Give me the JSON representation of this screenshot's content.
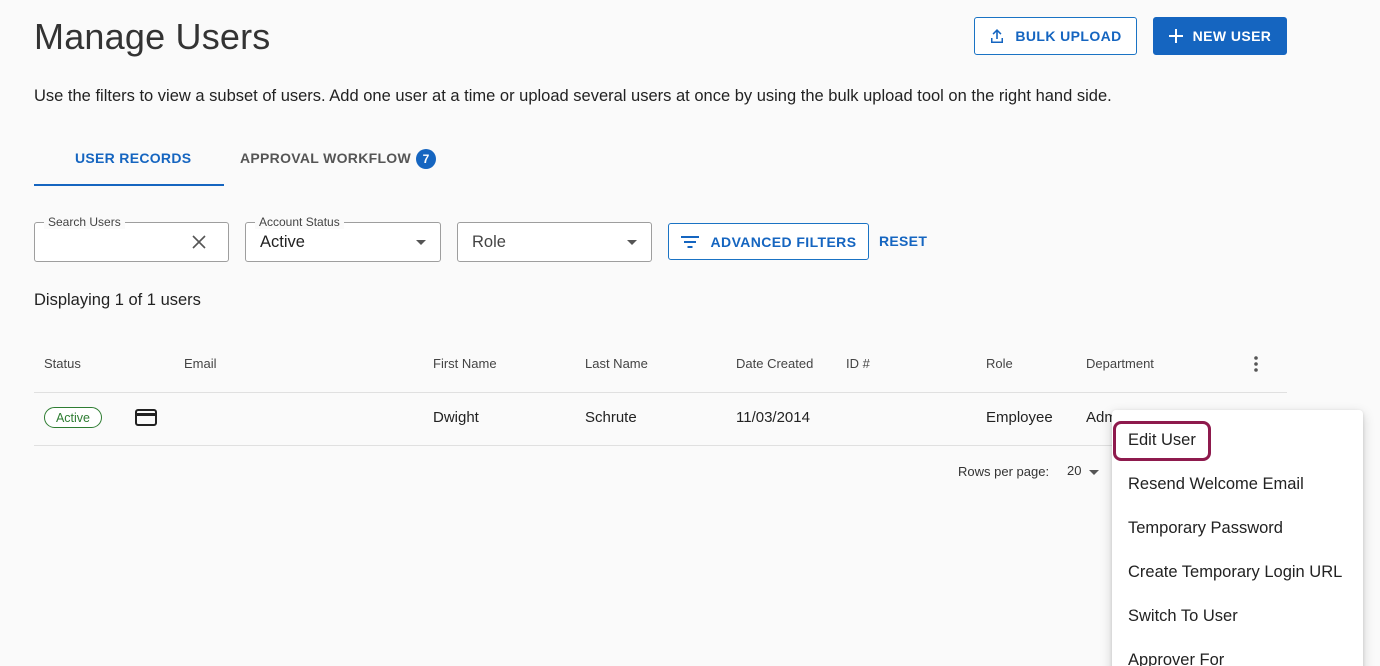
{
  "header": {
    "title": "Manage Users",
    "bulk_upload_label": "BULK UPLOAD",
    "new_user_label": "NEW USER"
  },
  "description": "Use the filters to view a subset of users. Add one user at a time or upload several users at once by using the bulk upload tool on the right hand side.",
  "tabs": {
    "records": "USER RECORDS",
    "approval": "APPROVAL WORKFLOW",
    "approval_badge": "7"
  },
  "filters": {
    "search_label": "Search Users",
    "status_label": "Account Status",
    "status_value": "Active",
    "role_placeholder": "Role",
    "advanced_label": "ADVANCED FILTERS",
    "reset_label": "RESET"
  },
  "display_count": "Displaying 1 of 1 users",
  "table": {
    "headers": {
      "status": "Status",
      "email": "Email",
      "first_name": "First Name",
      "last_name": "Last Name",
      "date_created": "Date Created",
      "id": "ID #",
      "role": "Role",
      "department": "Department"
    },
    "rows": [
      {
        "status": "Active",
        "email": "",
        "first_name": "Dwight",
        "last_name": "Schrute",
        "date_created": "11/03/2014",
        "id": "",
        "role": "Employee",
        "department": "Adm"
      }
    ]
  },
  "pagination": {
    "rows_label": "Rows per page:",
    "rows_value": "20"
  },
  "context_menu": {
    "items": [
      "Edit User",
      "Resend Welcome Email",
      "Temporary Password",
      "Create Temporary Login URL",
      "Switch To User",
      "Approver For"
    ],
    "highlighted": "Edit User"
  },
  "colors": {
    "primary": "#1565c0",
    "active_green": "#2e7d32",
    "highlight_border": "#8e1a4d"
  }
}
